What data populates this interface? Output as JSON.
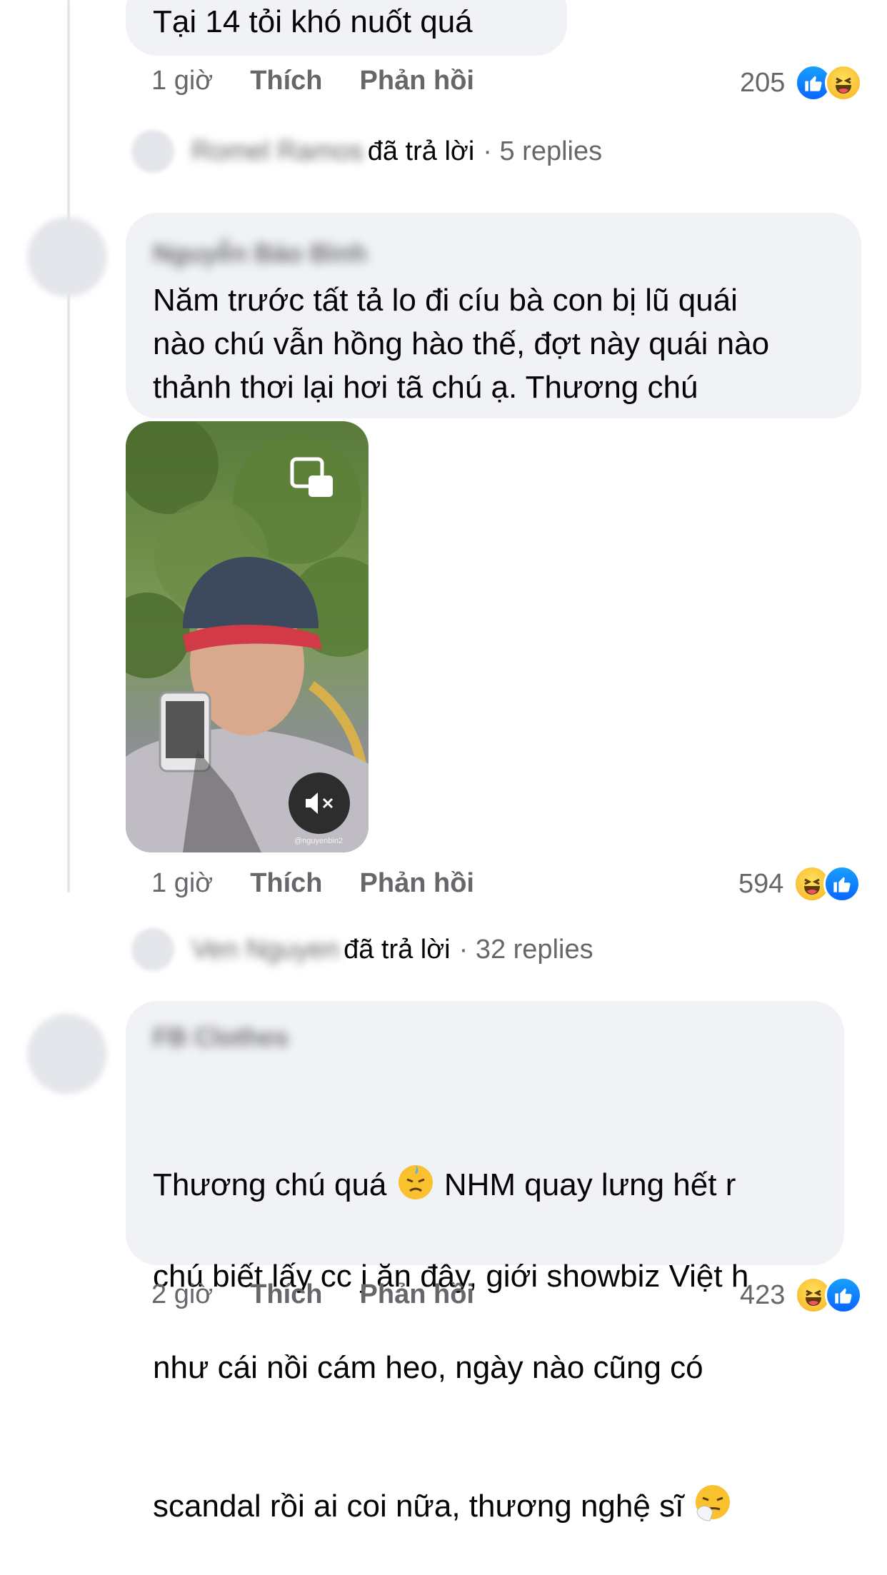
{
  "comment1": {
    "text": "Tại 14 tỏi khó nuốt quá",
    "time": "1 giờ",
    "like": "Thích",
    "reply": "Phản hồi",
    "reaction_count": "205",
    "reactions": [
      "like-icon",
      "haha-icon"
    ],
    "replies": {
      "author": "Romel Ramos",
      "action": "đã trả lời",
      "count": "· 5 replies"
    }
  },
  "comment2": {
    "author": "Nguyễn Bảo Bình",
    "text": "Năm trước tất tả lo đi cíu bà con bị lũ quái\nnào chú vẫn hồng hào thế, đợt này quái nào\nthảnh thơi lại hơi tã chú ạ. Thương chú",
    "video_watermark": "@nguyenbin2",
    "time": "1 giờ",
    "like": "Thích",
    "reply": "Phản hồi",
    "reaction_count": "594",
    "reactions": [
      "haha-icon",
      "like-icon"
    ],
    "replies": {
      "author": "Ven Nguyen",
      "action": "đã trả lời",
      "count": "· 32 replies"
    }
  },
  "comment3": {
    "author": "FB Clothes",
    "text_line1_a": "Thương chú quá ",
    "text_line1_b": " NHM quay lưng hết r",
    "text_line2": "chú biết lấy cc j ăn đây, giới showbiz Việt h",
    "text_line3": "như cái nồi cám heo, ngày nào cũng có",
    "text_line4": "scandal rồi ai coi nữa, thương nghệ sĩ ",
    "emojis": [
      "sweat-face-icon",
      "sneezing-face-icon"
    ],
    "time": "2 giờ",
    "like": "Thích",
    "reply": "Phản hồi",
    "reaction_count": "423",
    "reactions": [
      "haha-icon",
      "like-icon"
    ]
  },
  "colors": {
    "bubble": "#f0f2f5",
    "meta": "#65676b",
    "like": "#0866ff",
    "haha": "#f7b125"
  }
}
